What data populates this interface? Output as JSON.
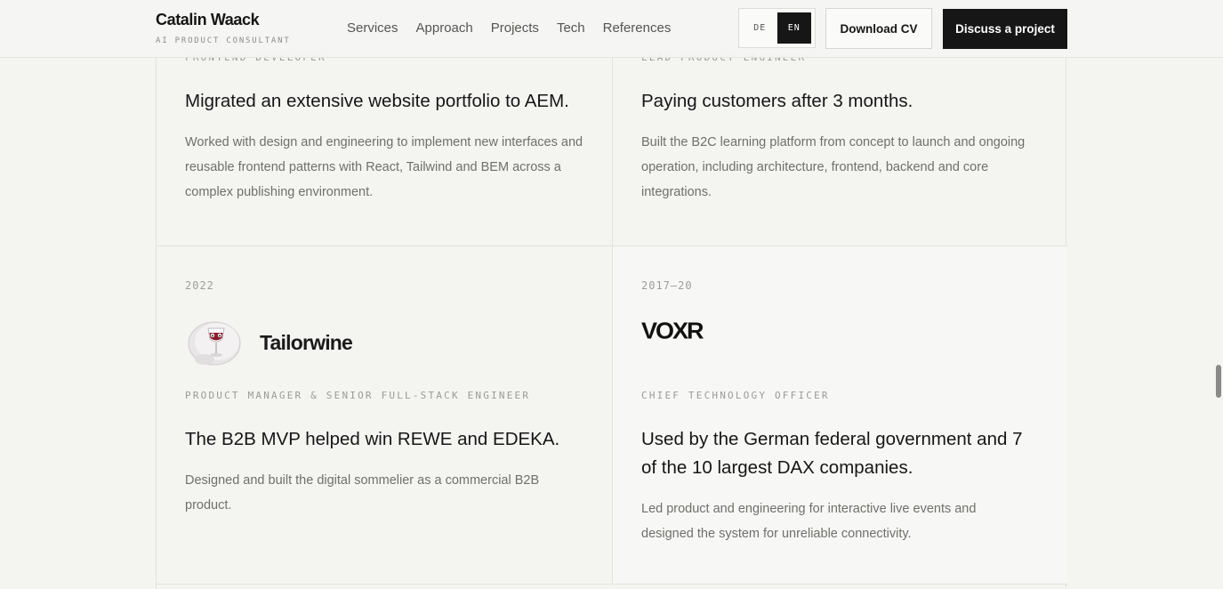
{
  "header": {
    "brand_name": "Catalin Waack",
    "brand_subtitle": "AI PRODUCT CONSULTANT",
    "nav": [
      "Services",
      "Approach",
      "Projects",
      "Tech",
      "References"
    ],
    "lang_de": "DE",
    "lang_en": "EN",
    "lang_selected": "EN",
    "download_cv": "Download CV",
    "discuss_project": "Discuss a project"
  },
  "projects": {
    "top_left": {
      "role": "FRONTEND DEVELOPER",
      "headline": "Migrated an extensive website portfolio to AEM.",
      "description": "Worked with design and engineering to implement new interfaces and reusable frontend patterns with React, Tailwind and BEM across a complex publishing environment."
    },
    "top_right": {
      "role": "LEAD PRODUCT ENGINEER",
      "headline": "Paying customers after 3 months.",
      "description": "Built the B2C learning platform from concept to launch and ongoing operation, including architecture, frontend, backend and core integrations."
    },
    "bottom_left": {
      "year": "2022",
      "company": "Tailorwine",
      "role": "PRODUCT MANAGER & SENIOR FULL-STACK ENGINEER",
      "headline": "The B2B MVP helped win REWE and EDEKA.",
      "description": "Designed and built the digital sommelier as a commercial B2B product."
    },
    "bottom_right": {
      "year": "2017–20",
      "company": "VOXR",
      "role": "CHIEF TECHNOLOGY OFFICER",
      "headline": "Used by the German federal government and 7 of the 10 largest DAX companies.",
      "description": "Led product and engineering for interactive live events and designed the system for unreliable connectivity."
    }
  },
  "colors": {
    "background": "#f4f4f1",
    "primary_dark": "#161616",
    "muted_text": "#6f6f6b",
    "border": "#e2e2de",
    "wine_red": "#8b1a2b"
  }
}
